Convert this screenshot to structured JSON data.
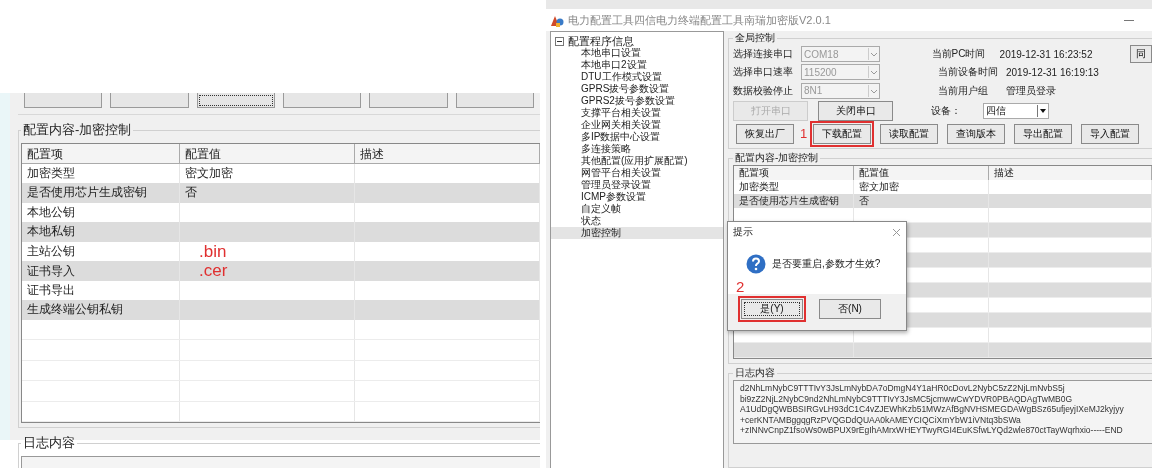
{
  "left_panel": {
    "toolbar_buttons": [
      {
        "focused": false
      },
      {
        "focused": false
      },
      {
        "focused": true
      },
      {
        "focused": false
      },
      {
        "focused": false
      },
      {
        "focused": false
      }
    ],
    "config_group": {
      "title": "配置内容-加密控制",
      "columns": [
        "配置项",
        "配置值",
        "描述"
      ],
      "rows": [
        {
          "item": "加密类型",
          "value": "密文加密"
        },
        {
          "item": "是否使用芯片生成密钥",
          "value": "否"
        },
        {
          "item": "本地公钥"
        },
        {
          "item": "本地私钥"
        },
        {
          "item": "主站公钥",
          "annotation": ".bin"
        },
        {
          "item": "证书导入",
          "annotation": ".cer"
        },
        {
          "item": "证书导出"
        },
        {
          "item": "生成终端公钥私钥"
        }
      ]
    },
    "log_group": {
      "title": "日志内容"
    }
  },
  "right_window": {
    "title": "电力配置工具四信电力终端配置工具南瑞加密版V2.0.1",
    "tree": {
      "label": "配置程序信息",
      "expanded": true,
      "children": [
        {
          "label": "本地串口设置",
          "selected": false
        },
        {
          "label": "本地串口2设置",
          "selected": false
        },
        {
          "label": "DTU工作模式设置",
          "selected": false
        },
        {
          "label": "GPRS拔号参数设置",
          "selected": false
        },
        {
          "label": "GPRS2拔号参数设置",
          "selected": false
        },
        {
          "label": "支撑平台相关设置",
          "selected": false
        },
        {
          "label": "企业网关相关设置",
          "selected": false
        },
        {
          "label": "多IP数据中心设置",
          "selected": false
        },
        {
          "label": "多连接策略",
          "selected": false
        },
        {
          "label": "其他配置(应用扩展配置)",
          "selected": false
        },
        {
          "label": "网管平台相关设置",
          "selected": false
        },
        {
          "label": "管理员登录设置",
          "selected": false
        },
        {
          "label": "ICMP参数设置",
          "selected": false
        },
        {
          "label": "自定义帧",
          "selected": false
        },
        {
          "label": "状态",
          "selected": false
        },
        {
          "label": "加密控制",
          "selected": true
        }
      ]
    },
    "global_control": {
      "title": "全局控制",
      "selects": [
        {
          "label": "选择连接串口",
          "value": "COM18",
          "disabled": true
        },
        {
          "label": "选择串口速率",
          "value": "115200",
          "disabled": true
        },
        {
          "label": "数据校验停止",
          "value": "8N1",
          "disabled": true
        }
      ],
      "info": [
        {
          "label": "当前PC时间",
          "value": "2019-12-31 16:23:52"
        },
        {
          "label": "当前设备时间",
          "value": "2019-12-31 16:19:13"
        },
        {
          "label": "当前用户组",
          "value": "管理员登录"
        }
      ],
      "side_button": "同",
      "port_buttons": [
        {
          "label": "打开串口",
          "disabled": true
        },
        {
          "label": "关闭串口",
          "disabled": false
        }
      ],
      "device": {
        "label": "设备：",
        "value": "四信"
      },
      "actions": [
        {
          "label": "恢复出厂",
          "highlighted": false
        },
        {
          "label": "下载配置",
          "highlighted": true,
          "step": "1"
        },
        {
          "label": "读取配置",
          "highlighted": false
        },
        {
          "label": "查询版本",
          "highlighted": false
        },
        {
          "label": "导出配置",
          "highlighted": false
        },
        {
          "label": "导入配置",
          "highlighted": false
        }
      ]
    },
    "config_group": {
      "title": "配置内容-加密控制",
      "columns": [
        "配置项",
        "配置值",
        "描述"
      ],
      "rows": [
        {
          "item": "加密类型",
          "value": "密文加密"
        },
        {
          "item": "是否使用芯片生成密钥",
          "value": "否"
        }
      ]
    },
    "dialog": {
      "title": "提示",
      "message": "是否要重启,参数才生效?",
      "step": "2",
      "buttons": [
        {
          "label": "是(Y)",
          "highlighted": true
        },
        {
          "label": "否(N)",
          "highlighted": false
        }
      ]
    },
    "log_group": {
      "title": "日志内容",
      "lines": [
        "d2NhLmNybC9TTTIvY3JsLmNybDA7oDmgN4Y1aHR0cDovL2NybC5zZ2NjLmNvbS5j",
        "bi9zZ2NjL2NybC9nd2NhLmNybC9TTTIvY3JsMC5jcmwwCwYDVR0PBAQDAgTwMB0G",
        "A1UdDgQWBBSIRGvLH93dC1C4vZJEWhKzb51MWzAfBgNVHSMEGDAWgBSz65ufjeyjIXeMJ2kyjyy",
        "+cerKNTAMBggqgRzPVQGDdQUAA0kAMEYCIQCiXmYbW1iVNtq3bSWa",
        "+zINNvCnpZ1fsoWs0wBPUX9rEgIhAMrxWHEYTwyRGI4EuKSfwLYQd2wle870ctTayWqrhxio-----END"
      ]
    }
  }
}
